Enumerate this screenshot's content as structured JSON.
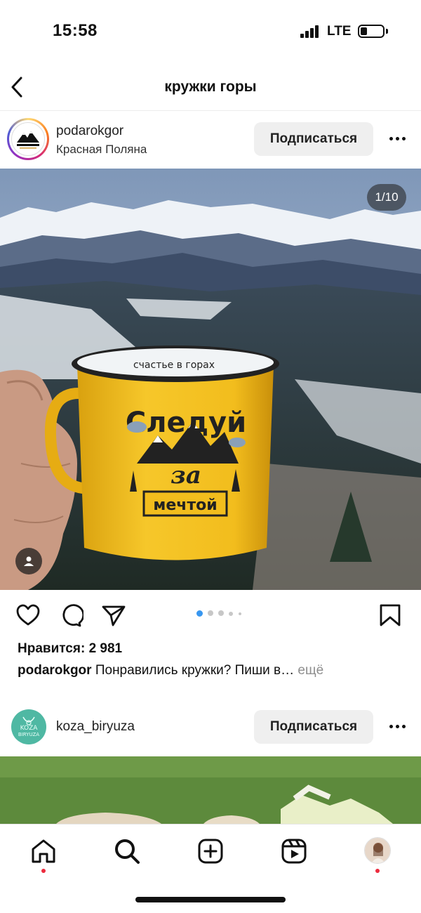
{
  "status_bar": {
    "time": "15:58",
    "network": "LTE",
    "battery_level": 0.25
  },
  "nav": {
    "title": "кружки горы",
    "back_icon": "chevron-left-icon"
  },
  "post1": {
    "username": "podarokgor",
    "location": "Красная Поляна",
    "follow_label": "Подписаться",
    "more_icon": "more-horizontal-icon",
    "avatar_text": "PODAROKGOR",
    "photo": {
      "counter": "1/10",
      "mug_rim_text": "счастье в горах",
      "mug_text_1": "Следуй",
      "mug_text_2": "за",
      "mug_text_3": "мечтой",
      "tag_icon": "person-tag-icon"
    },
    "carousel": {
      "total_dots": 5,
      "active_index": 0
    },
    "likes_label": "Нравится:",
    "likes_count": "2 981",
    "caption_user": "podarokgor",
    "caption_text": "Понравились кружки? Пиши в…",
    "caption_more": "ещё"
  },
  "post2": {
    "username": "koza_biryuza",
    "follow_label": "Подписаться",
    "avatar_text_1": "KOZA",
    "avatar_text_2": "BIRYUZA"
  },
  "tab_bar": {
    "items": [
      {
        "name": "home",
        "icon": "home-icon",
        "has_dot": true
      },
      {
        "name": "search",
        "icon": "search-icon",
        "has_dot": false
      },
      {
        "name": "create",
        "icon": "plus-square-icon",
        "has_dot": false
      },
      {
        "name": "reels",
        "icon": "reels-icon",
        "has_dot": false
      },
      {
        "name": "profile",
        "icon": "profile-avatar",
        "has_dot": true
      }
    ]
  },
  "colors": {
    "follow_bg": "#efefef",
    "active_dot": "#3897f0",
    "notification_dot": "#ed2b3d",
    "mug_yellow": "#f2bd1d"
  }
}
